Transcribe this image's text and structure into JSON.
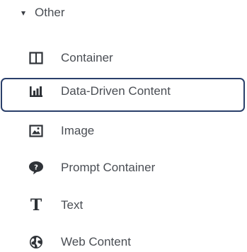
{
  "group": {
    "label": "Other",
    "expanded": true,
    "caret_icon": "caret-down-icon"
  },
  "items": [
    {
      "label": "Container",
      "icon": "container-icon",
      "selected": false
    },
    {
      "label": "Data-Driven Content",
      "icon": "bar-chart-icon",
      "selected": true
    },
    {
      "label": "Image",
      "icon": "image-icon",
      "selected": false
    },
    {
      "label": "Prompt Container",
      "icon": "prompt-bubble-icon",
      "selected": false
    },
    {
      "label": "Text",
      "icon": "text-t-icon",
      "selected": false
    },
    {
      "label": "Web Content",
      "icon": "globe-icon",
      "selected": false
    }
  ],
  "colors": {
    "text": "#4a4e54",
    "icon": "#2f3338",
    "selection_border": "#2a3f6a"
  }
}
